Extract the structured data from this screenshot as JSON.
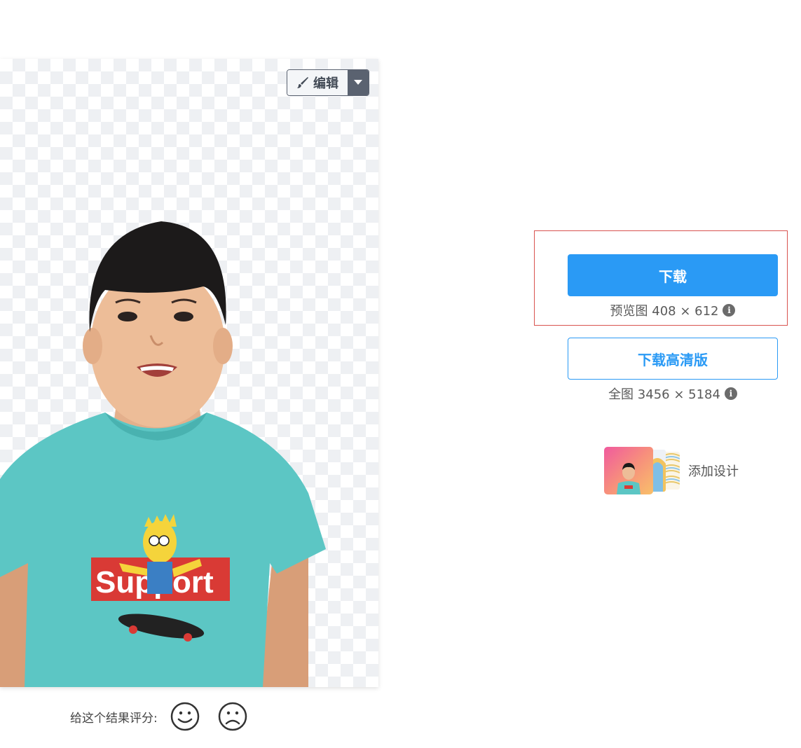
{
  "editor": {
    "edit_label": "编辑",
    "brush_icon": "brush-icon",
    "dropdown_icon": "caret-down-icon"
  },
  "rating": {
    "label": "给这个结果评分:",
    "good_icon": "smile-face-icon",
    "bad_icon": "sad-face-icon"
  },
  "download": {
    "label": "下载",
    "preview_info": "预览图 408 × 612"
  },
  "download_hd": {
    "label": "下载高清版",
    "full_info": "全图 3456 × 5184"
  },
  "add_design": {
    "label": "添加设计"
  },
  "colors": {
    "primary": "#2a9af5",
    "highlight_border": "#d9534f",
    "edit_dark": "#5a6270",
    "shirt": "#5cc6c4",
    "shirt_logo_red": "#d93a35"
  },
  "shirt_text": "Support"
}
